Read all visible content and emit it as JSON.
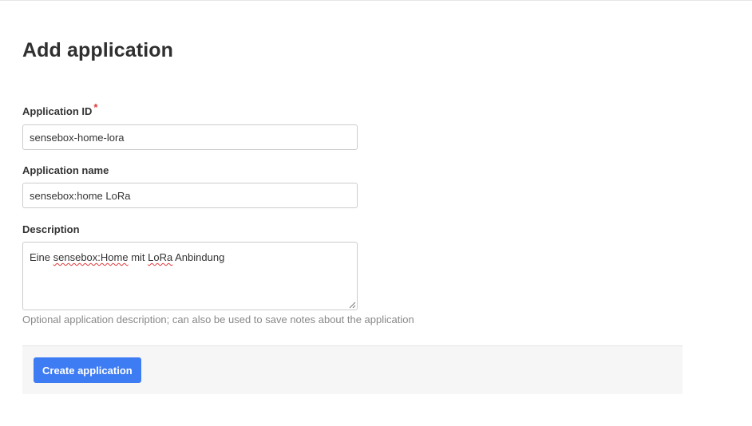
{
  "page": {
    "title": "Add application"
  },
  "form": {
    "application_id": {
      "label": "Application ID",
      "required_marker": "*",
      "value": "sensebox-home-lora"
    },
    "application_name": {
      "label": "Application name",
      "value": "sensebox:home LoRa"
    },
    "description": {
      "label": "Description",
      "value_parts": [
        "Eine ",
        "sensebox:Home",
        " mit ",
        "LoRa",
        " Anbindung"
      ],
      "hint": "Optional application description; can also be used to save notes about the application"
    }
  },
  "actions": {
    "create_label": "Create application"
  },
  "colors": {
    "primary_button": "#3e7cf4",
    "required": "#e03a3a",
    "hint_text": "#888888",
    "action_bar_bg": "#f6f6f6"
  }
}
